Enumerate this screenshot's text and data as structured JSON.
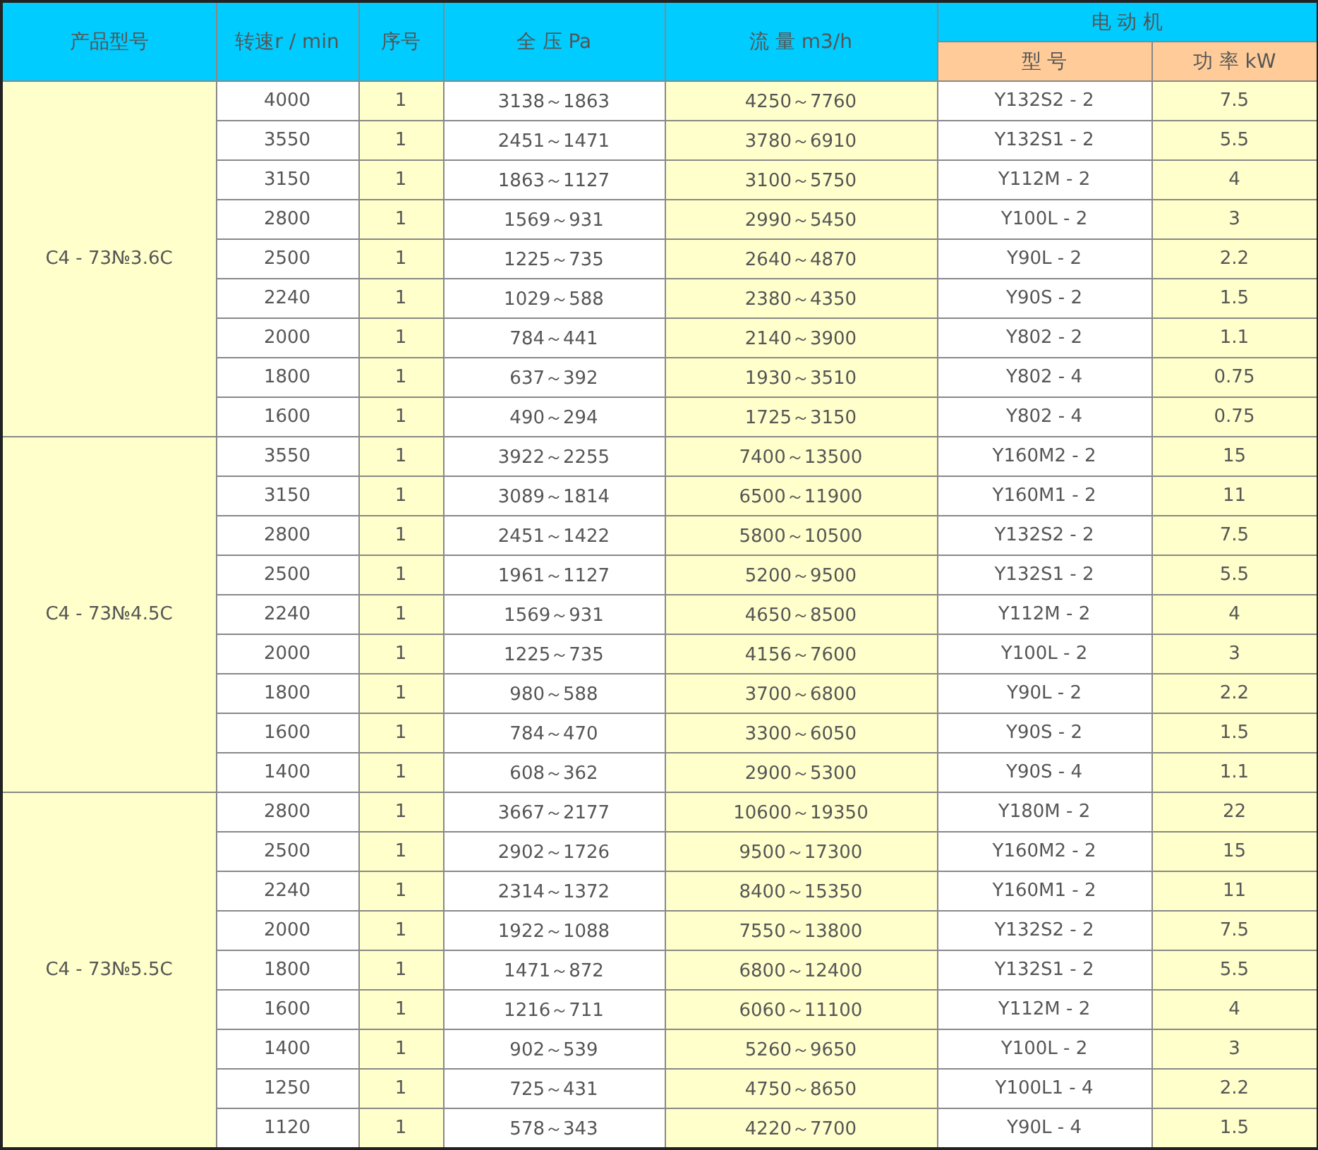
{
  "table": {
    "columns": [
      "产品型号",
      "转速r / min",
      "序号",
      "全 压 Pa",
      "流 量 m3/h"
    ],
    "motor_header": "电 动 机",
    "motor_columns": [
      "型 号",
      "功 率 kW"
    ],
    "groups": [
      {
        "model": "C4 - 73№3.6C",
        "rows": [
          [
            "4000",
            "1",
            "3138～1863",
            "4250～7760",
            "Y132S2 - 2",
            "7.5"
          ],
          [
            "3550",
            "1",
            "2451～1471",
            "3780～6910",
            "Y132S1 - 2",
            "5.5"
          ],
          [
            "3150",
            "1",
            "1863～1127",
            "3100～5750",
            "Y112M - 2",
            "4"
          ],
          [
            "2800",
            "1",
            "1569～931",
            "2990～5450",
            "Y100L - 2",
            "3"
          ],
          [
            "2500",
            "1",
            "1225～735",
            "2640～4870",
            "Y90L - 2",
            "2.2"
          ],
          [
            "2240",
            "1",
            "1029～588",
            "2380～4350",
            "Y90S - 2",
            "1.5"
          ],
          [
            "2000",
            "1",
            "784～441",
            "2140～3900",
            "Y802 - 2",
            "1.1"
          ],
          [
            "1800",
            "1",
            "637～392",
            "1930～3510",
            "Y802 - 4",
            "0.75"
          ],
          [
            "1600",
            "1",
            "490～294",
            "1725～3150",
            "Y802 - 4",
            "0.75"
          ]
        ]
      },
      {
        "model": "C4 - 73№4.5C",
        "rows": [
          [
            "3550",
            "1",
            "3922～2255",
            "7400～13500",
            "Y160M2 - 2",
            "15"
          ],
          [
            "3150",
            "1",
            "3089～1814",
            "6500～11900",
            "Y160M1 - 2",
            "11"
          ],
          [
            "2800",
            "1",
            "2451～1422",
            "5800～10500",
            "Y132S2 - 2",
            "7.5"
          ],
          [
            "2500",
            "1",
            "1961～1127",
            "5200～9500",
            "Y132S1 - 2",
            "5.5"
          ],
          [
            "2240",
            "1",
            "1569～931",
            "4650～8500",
            "Y112M - 2",
            "4"
          ],
          [
            "2000",
            "1",
            "1225～735",
            "4156～7600",
            "Y100L - 2",
            "3"
          ],
          [
            "1800",
            "1",
            "980～588",
            "3700～6800",
            "Y90L - 2",
            "2.2"
          ],
          [
            "1600",
            "1",
            "784～470",
            "3300～6050",
            "Y90S - 2",
            "1.5"
          ],
          [
            "1400",
            "1",
            "608～362",
            "2900～5300",
            "Y90S - 4",
            "1.1"
          ]
        ]
      },
      {
        "model": "C4 - 73№5.5C",
        "rows": [
          [
            "2800",
            "1",
            "3667～2177",
            "10600～19350",
            "Y180M - 2",
            "22"
          ],
          [
            "2500",
            "1",
            "2902～1726",
            "9500～17300",
            "Y160M2 - 2",
            "15"
          ],
          [
            "2240",
            "1",
            "2314～1372",
            "8400～15350",
            "Y160M1 - 2",
            "11"
          ],
          [
            "2000",
            "1",
            "1922～1088",
            "7550～13800",
            "Y132S2 - 2",
            "7.5"
          ],
          [
            "1800",
            "1",
            "1471～872",
            "6800～12400",
            "Y132S1 - 2",
            "5.5"
          ],
          [
            "1600",
            "1",
            "1216～711",
            "6060～11100",
            "Y112M - 2",
            "4"
          ],
          [
            "1400",
            "1",
            "902～539",
            "5260～9650",
            "Y100L - 2",
            "3"
          ],
          [
            "1250",
            "1",
            "725～431",
            "4750～8650",
            "Y100L1 - 4",
            "2.2"
          ],
          [
            "1120",
            "1",
            "578～343",
            "4220～7700",
            "Y90L - 4",
            "1.5"
          ]
        ]
      }
    ]
  }
}
